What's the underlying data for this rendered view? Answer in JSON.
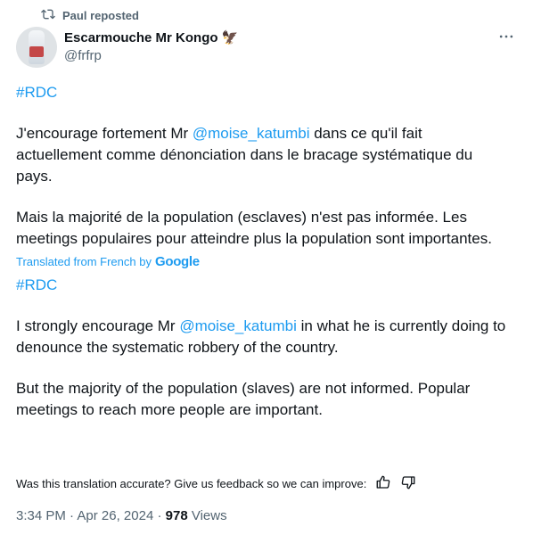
{
  "repost": {
    "text": "Paul reposted"
  },
  "author": {
    "name": "Escarmouche Mr Kongo",
    "handle": "@frfrp"
  },
  "original": {
    "hashtag": "#RDC",
    "p1_before": "J'encourage fortement Mr ",
    "p1_mention": "@moise_katumbi",
    "p1_after": " dans ce qu'il fait actuellement comme dénonciation dans le bracage systématique du pays.",
    "p2": "Mais la majorité de la population (esclaves) n'est pas informée. Les meetings populaires pour atteindre plus la population sont importantes."
  },
  "translation": {
    "label": "Translated from French by",
    "provider": "Google",
    "hashtag": "#RDC",
    "p1_before": "I strongly encourage Mr ",
    "p1_mention": "@moise_katumbi",
    "p1_after": " in what he is currently doing to denounce the systematic robbery of the country.",
    "p2": "But the majority of the population (slaves) are not informed. Popular meetings to reach more people are important."
  },
  "feedback": {
    "question": "Was this translation accurate? Give us feedback so we can improve:"
  },
  "meta": {
    "time": "3:34 PM",
    "sep1": "·",
    "date": "Apr 26, 2024",
    "sep2": "·",
    "views_count": "978",
    "views_label": "Views"
  },
  "icons": {
    "repost": "repost-icon",
    "verified_emoji": "eagle-emoji-icon",
    "more": "more-icon",
    "thumbs_up": "thumbs-up-icon",
    "thumbs_down": "thumbs-down-icon"
  },
  "colors": {
    "accent": "#1d9bf0",
    "secondary_text": "#536471",
    "text": "#0f1419"
  }
}
